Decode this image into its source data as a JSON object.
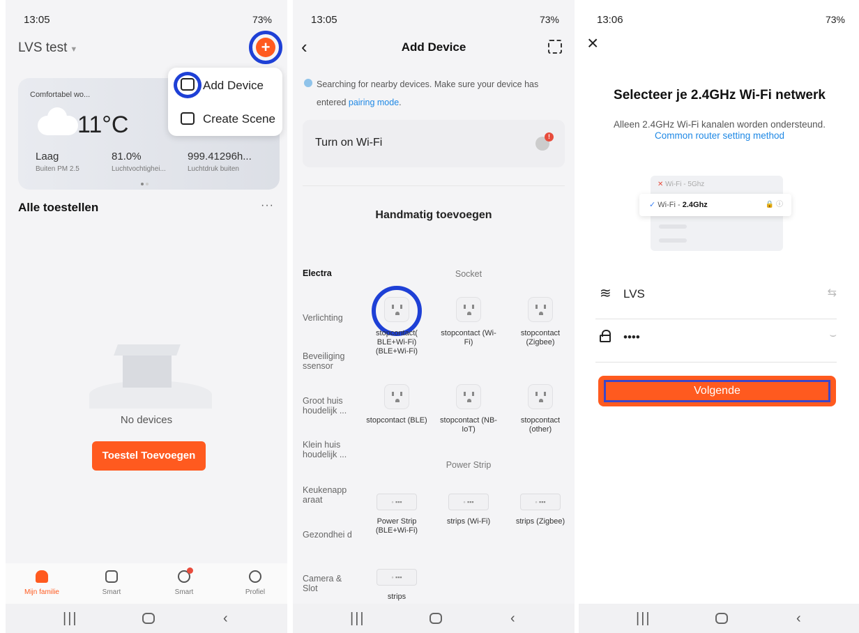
{
  "phone1": {
    "status_time": "13:05",
    "status_right": "73%",
    "family": "LVS test",
    "plus_label": "+",
    "popup": {
      "add_device": "Add Device",
      "create_scene": "Create Scene"
    },
    "weather": {
      "location": "Comfortabel wo...",
      "temp": "11°C",
      "metrics": [
        {
          "value": "Laag",
          "label": "Buiten PM 2.5"
        },
        {
          "value": "81.0%",
          "label": "Luchtvochtighei..."
        },
        {
          "value": "999.41296h...",
          "label": "Luchtdruk buiten"
        }
      ]
    },
    "section_title": "Alle toestellen",
    "more": "···",
    "empty_text": "No devices",
    "add_button": "Toestel Toevoegen",
    "tabs": [
      {
        "label": "Mijn familie",
        "icon": "home-icon"
      },
      {
        "label": "Smart",
        "icon": "checkbox-icon"
      },
      {
        "label": "Smart",
        "icon": "smart-icon"
      },
      {
        "label": "Profiel",
        "icon": "profile-icon"
      }
    ]
  },
  "phone2": {
    "status_time": "13:05",
    "status_right": "73%",
    "title": "Add Device",
    "search_text": "Searching for nearby devices. Make sure your device has entered ",
    "search_link": "pairing mode",
    "search_end": ".",
    "wifi_card": "Turn on Wi-Fi",
    "manual_title": "Handmatig toevoegen",
    "categories": [
      "Electra",
      "Verlichting",
      "Beveiliging ssensor",
      "Groot huis houdelijk ...",
      "Klein huis houdelijk ...",
      "Keukenapp araat",
      "Gezondhei d",
      "Camera & Slot"
    ],
    "socket_header": "Socket",
    "power_strip_header": "Power Strip",
    "sockets": [
      "stopcontact( BLE+Wi-Fi) (BLE+Wi-Fi)",
      "stopcontact (Wi-Fi)",
      "stopcontact (Zigbee)",
      "stopcontact (BLE)",
      "stopcontact (NB-IoT)",
      "stopcontact (other)"
    ],
    "strips": [
      "Power Strip (BLE+Wi-Fi)",
      "strips (Wi-Fi)",
      "strips (Zigbee)",
      "strips"
    ]
  },
  "phone3": {
    "status_time": "13:06",
    "status_right": "73%",
    "title": "Selecteer je 2.4GHz Wi-Fi netwerk",
    "subtitle": "Alleen 2.4GHz Wi-Fi kanalen worden ondersteund.",
    "link": "Common router setting method",
    "illus_5g": "Wi-Fi - 5Ghz",
    "illus_24_prefix": "Wi-Fi - ",
    "illus_24": "2.4Ghz",
    "ssid": "LVS",
    "password": "••••",
    "next_button": "Volgende"
  },
  "colors": {
    "accent": "#ff5a1f",
    "highlight": "#1e40d6",
    "link": "#1e88e5"
  }
}
